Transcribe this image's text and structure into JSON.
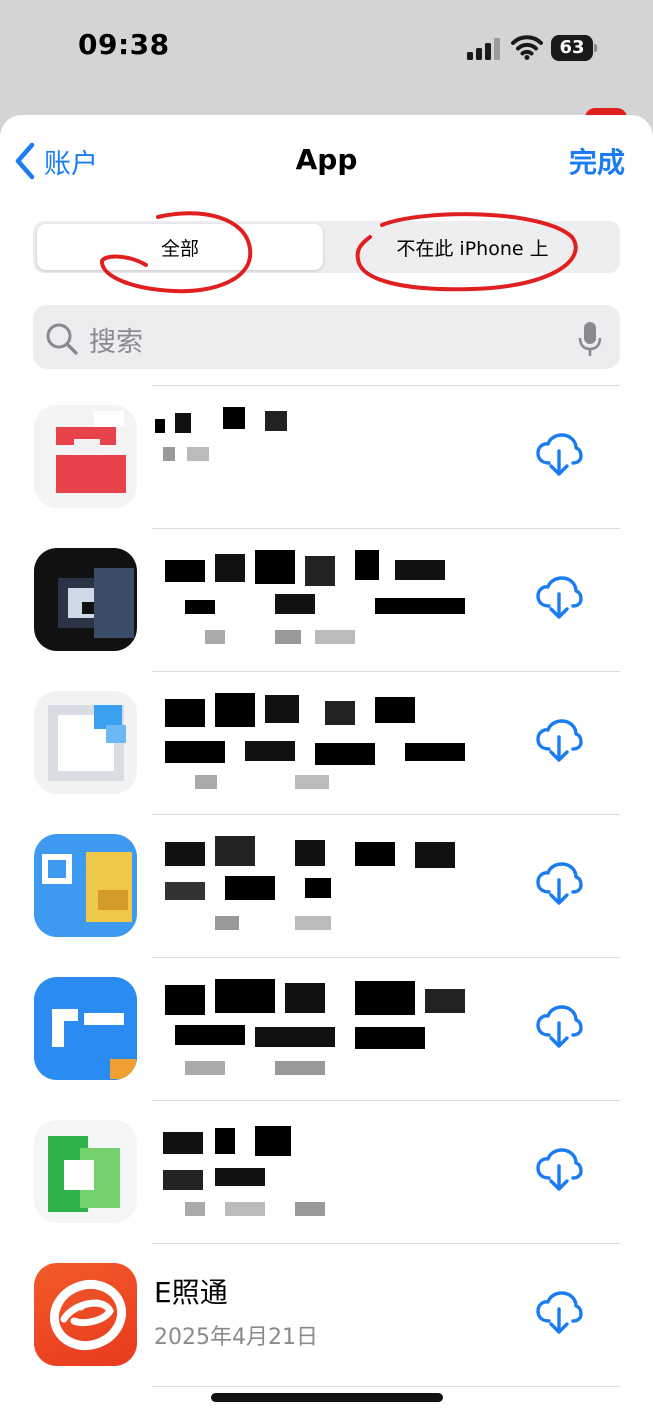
{
  "status_bar": {
    "time": "09:38",
    "battery": "63"
  },
  "nav": {
    "back_label": "账户",
    "title": "App",
    "done_label": "完成"
  },
  "segments": {
    "all": "全部",
    "not_on_iphone": "不在此 iPhone 上",
    "selected": "all"
  },
  "search": {
    "placeholder": "搜索"
  },
  "apps": [
    {
      "name": "",
      "date": "",
      "icon": "app-icon-redacted"
    },
    {
      "name": "",
      "date": "",
      "icon": "app-icon-redacted"
    },
    {
      "name": "",
      "date": "",
      "icon": "app-icon-redacted"
    },
    {
      "name": "",
      "date": "",
      "icon": "app-icon-redacted"
    },
    {
      "name": "",
      "date": "",
      "icon": "app-icon-redacted"
    },
    {
      "name": "",
      "date": "",
      "icon": "app-icon-redacted"
    },
    {
      "name": "E照通",
      "date": "2025年4月21日",
      "icon": "e-zhaotong-icon"
    }
  ],
  "colors": {
    "accent": "#1a7cf2",
    "annotation": "#e02020",
    "row_action_icon": "cloud-download-icon"
  }
}
